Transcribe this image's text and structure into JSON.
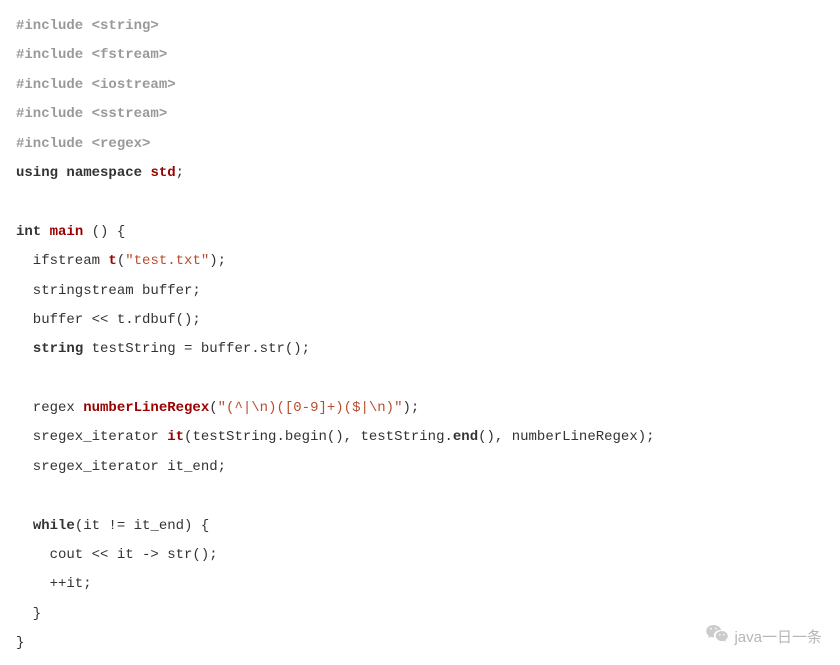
{
  "code": {
    "inc_string": "#include <string>",
    "inc_fstream": "#include <fstream>",
    "inc_iostream": "#include <iostream>",
    "inc_sstream": "#include <sstream>",
    "inc_regex": "#include <regex>",
    "kw_using": "using",
    "kw_namespace": "namespace",
    "id_std": "std",
    "semi": ";",
    "kw_int": "int",
    "id_main": "main",
    "main_tail": " () {",
    "ifstream_lead": "  ifstream ",
    "id_t": "t",
    "paren_open": "(",
    "str_testtxt": "\"test.txt\"",
    "paren_close_semi": ");",
    "stringstream_line": "  stringstream buffer;",
    "buffer_rdbuf_line": "  buffer << t.rdbuf();",
    "string_lead": "  ",
    "kw_string": "string",
    "string_tail": " testString = buffer.str();",
    "regex_lead": "  regex ",
    "id_regex": "numberLineRegex",
    "str_regex": "\"(^|\\n)([0-9]+)($|\\n)\"",
    "sregex1_lead": "  sregex_iterator ",
    "id_it": "it",
    "sregex1_mid": "(testString.begin(), testString.",
    "id_end": "end",
    "sregex1_tail": "(), numberLineRegex);",
    "sregex2_line": "  sregex_iterator it_end;",
    "while_lead": "  ",
    "kw_while": "while",
    "while_cond": "(it != it_end) {",
    "cout_line": "    cout << it -> str();",
    "incr_line": "    ++it;",
    "brace_in": "  }",
    "brace_out": "}"
  },
  "watermark": {
    "text": "java一日一条",
    "icon": "wechat-icon"
  }
}
